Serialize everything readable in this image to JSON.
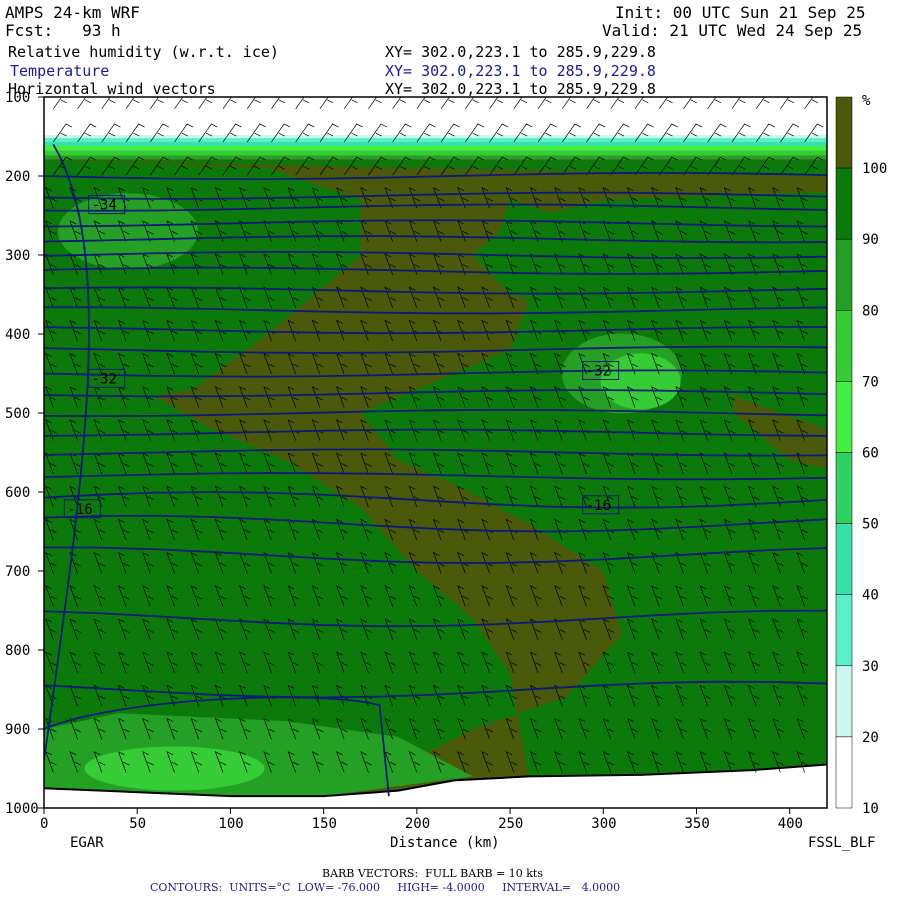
{
  "header": {
    "model": "AMPS 24-km WRF",
    "fcst": "Fcst:   93 h",
    "init": "Init: 00 UTC Sun 21 Sep 25",
    "valid": "Valid: 21 UTC Wed 24 Sep 25",
    "line_rh": "Relative humidity (w.r.t. ice)",
    "line_temp": "Temperature",
    "line_wind": "Horizontal wind vectors",
    "xy1": "XY= 302.0,223.1 to 285.9,229.8",
    "xy2": "XY= 302.0,223.1 to 285.9,229.8",
    "xy3": "XY= 302.0,223.1 to 285.9,229.8"
  },
  "footer": {
    "barb": "BARB VECTORS:  FULL BARB = 10 kts",
    "contours": "CONTOURS:  UNITS=°C  LOW= -76.000     HIGH= -4.0000     INTERVAL=   4.0000"
  },
  "colors": {
    "olive": "#4a5a0a",
    "dark_green": "#0b7a0b",
    "mid_green": "#24a024",
    "light_green": "#36cc36",
    "bright_green": "#41ee41",
    "temp_line": "#0a1a7a"
  },
  "chart_data": {
    "type": "heatmap",
    "xlabel": "Distance (km)",
    "ylabel": "",
    "xlim": [
      0,
      420
    ],
    "ylim": [
      1000,
      100
    ],
    "x_ticks": [
      "0",
      "50",
      "100",
      "150",
      "200",
      "250",
      "300",
      "350",
      "400"
    ],
    "y_ticks": [
      "100",
      "200",
      "300",
      "400",
      "500",
      "600",
      "700",
      "800",
      "900",
      "1000"
    ],
    "x_start_label": "EGAR",
    "x_end_label": "FSSL_BLF",
    "colorbar": {
      "unit": "%",
      "levels": [
        "100",
        "90",
        "80",
        "70",
        "60",
        "50",
        "40",
        "30",
        "20",
        "10"
      ],
      "colors": [
        "#4a5a0a",
        "#0b7a0b",
        "#24a024",
        "#36cc36",
        "#41ee41",
        "#2fd060",
        "#39e0a8",
        "#5cf0c8",
        "#ccf7ee",
        "#ffffff"
      ]
    },
    "temperature_labels": [
      {
        "text": "-34",
        "x": 25,
        "p": 240
      },
      {
        "text": "-32",
        "x": 25,
        "p": 460
      },
      {
        "text": "-32",
        "x": 290,
        "p": 450
      },
      {
        "text": "-16",
        "x": 12,
        "p": 625
      },
      {
        "text": "-16",
        "x": 290,
        "p": 620
      }
    ],
    "temperature_isobaric_levels": [
      200,
      225,
      240,
      260,
      280,
      300,
      320,
      345,
      370,
      395,
      420,
      450,
      475,
      500,
      525,
      550,
      580,
      610,
      640,
      680,
      760,
      850
    ],
    "terrain": [
      {
        "x": 0,
        "p": 975
      },
      {
        "x": 100,
        "p": 985
      },
      {
        "x": 150,
        "p": 985
      },
      {
        "x": 190,
        "p": 978
      },
      {
        "x": 220,
        "p": 965
      },
      {
        "x": 260,
        "p": 960
      },
      {
        "x": 320,
        "p": 958
      },
      {
        "x": 380,
        "p": 952
      },
      {
        "x": 420,
        "p": 945
      }
    ]
  }
}
